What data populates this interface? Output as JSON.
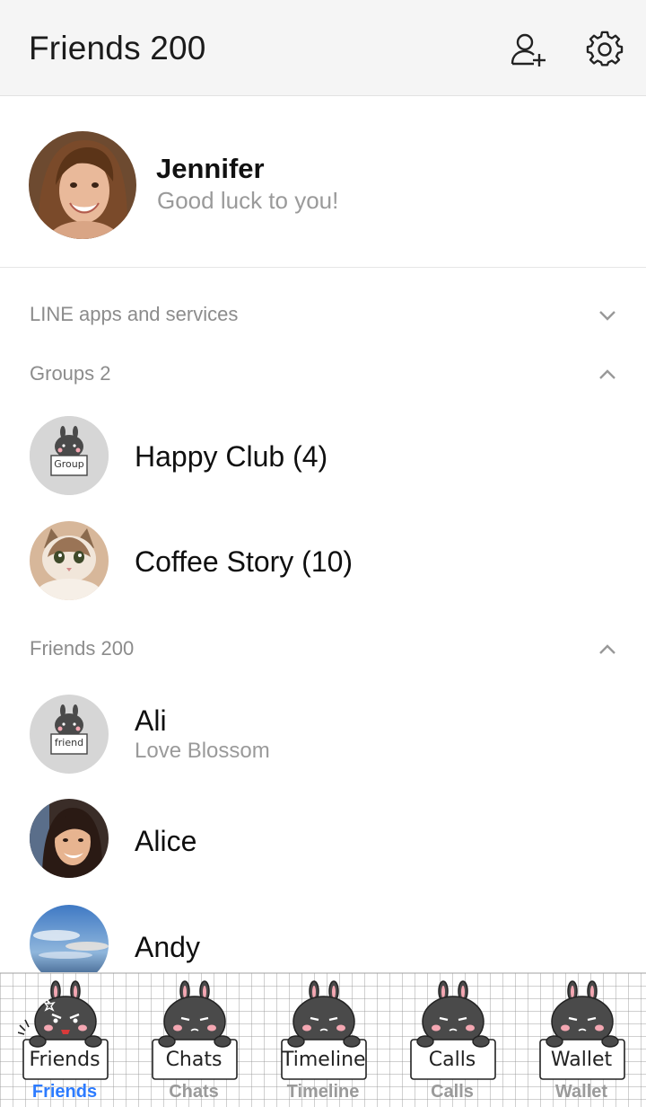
{
  "header": {
    "title": "Friends 200",
    "add_friend_icon": "add-friend-icon",
    "settings_icon": "gear-icon"
  },
  "profile": {
    "name": "Jennifer",
    "status": "Good luck to you!"
  },
  "sections": {
    "line_apps": {
      "label": "LINE apps and services",
      "chevron": "chevron-down-icon"
    },
    "groups": {
      "label": "Groups 2",
      "chevron": "chevron-up-icon"
    },
    "friends": {
      "label": "Friends 200",
      "chevron": "chevron-up-icon"
    }
  },
  "groups": [
    {
      "name": "Happy Club (4)",
      "avatar": "bunny-group-avatar",
      "sign": "Group"
    },
    {
      "name": "Coffee Story (10)",
      "avatar": "cat-photo-avatar"
    }
  ],
  "friends": [
    {
      "name": "Ali",
      "status": "Love Blossom",
      "avatar": "bunny-friend-avatar",
      "sign": "friend"
    },
    {
      "name": "Alice",
      "status": "",
      "avatar": "woman-photo-avatar"
    },
    {
      "name": "Andy",
      "status": "",
      "avatar": "sky-photo-avatar"
    }
  ],
  "tabs": [
    {
      "sign": "Friends",
      "label": "Friends",
      "active": true
    },
    {
      "sign": "Chats",
      "label": "Chats",
      "active": false
    },
    {
      "sign": "Timeline",
      "label": "Timeline",
      "active": false
    },
    {
      "sign": "Calls",
      "label": "Calls",
      "active": false
    },
    {
      "sign": "Wallet",
      "label": "Wallet",
      "active": false
    }
  ],
  "colors": {
    "accent": "#2c7bff",
    "header_bg": "#f5f5f5",
    "muted_text": "#9a9a9a",
    "bunny": "#4a4a4a",
    "blush": "#f4a7b2"
  }
}
